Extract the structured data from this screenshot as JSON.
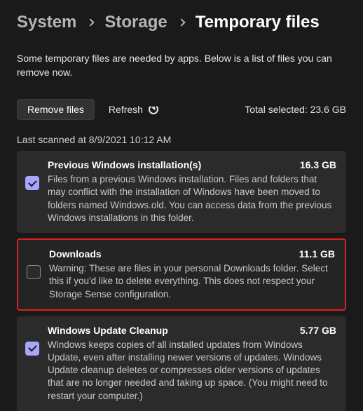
{
  "breadcrumb": {
    "system": "System",
    "storage": "Storage",
    "temp": "Temporary files"
  },
  "intro": "Some temporary files are needed by apps. Below is a list of files you can remove now.",
  "actions": {
    "remove": "Remove files",
    "refresh": "Refresh",
    "total_label": "Total selected:",
    "total_value": "23.6 GB"
  },
  "last_scanned": "Last scanned at 8/9/2021 10:12 AM",
  "items": [
    {
      "title": "Previous Windows installation(s)",
      "size": "16.3 GB",
      "checked": true,
      "highlight": false,
      "desc": "Files from a previous Windows installation.  Files and folders that may conflict with the installation of Windows have been moved to folders named Windows.old.  You can access data from the previous Windows installations in this folder."
    },
    {
      "title": "Downloads",
      "size": "11.1 GB",
      "checked": false,
      "highlight": true,
      "desc": "Warning: These are files in your personal Downloads folder. Select this if you'd like to delete everything. This does not respect your Storage Sense configuration."
    },
    {
      "title": "Windows Update Cleanup",
      "size": "5.77 GB",
      "checked": true,
      "highlight": false,
      "desc": "Windows keeps copies of all installed updates from Windows Update, even after installing newer versions of updates. Windows Update cleanup deletes or compresses older versions of updates that are no longer needed and taking up space. (You might need to restart your computer.)"
    }
  ]
}
